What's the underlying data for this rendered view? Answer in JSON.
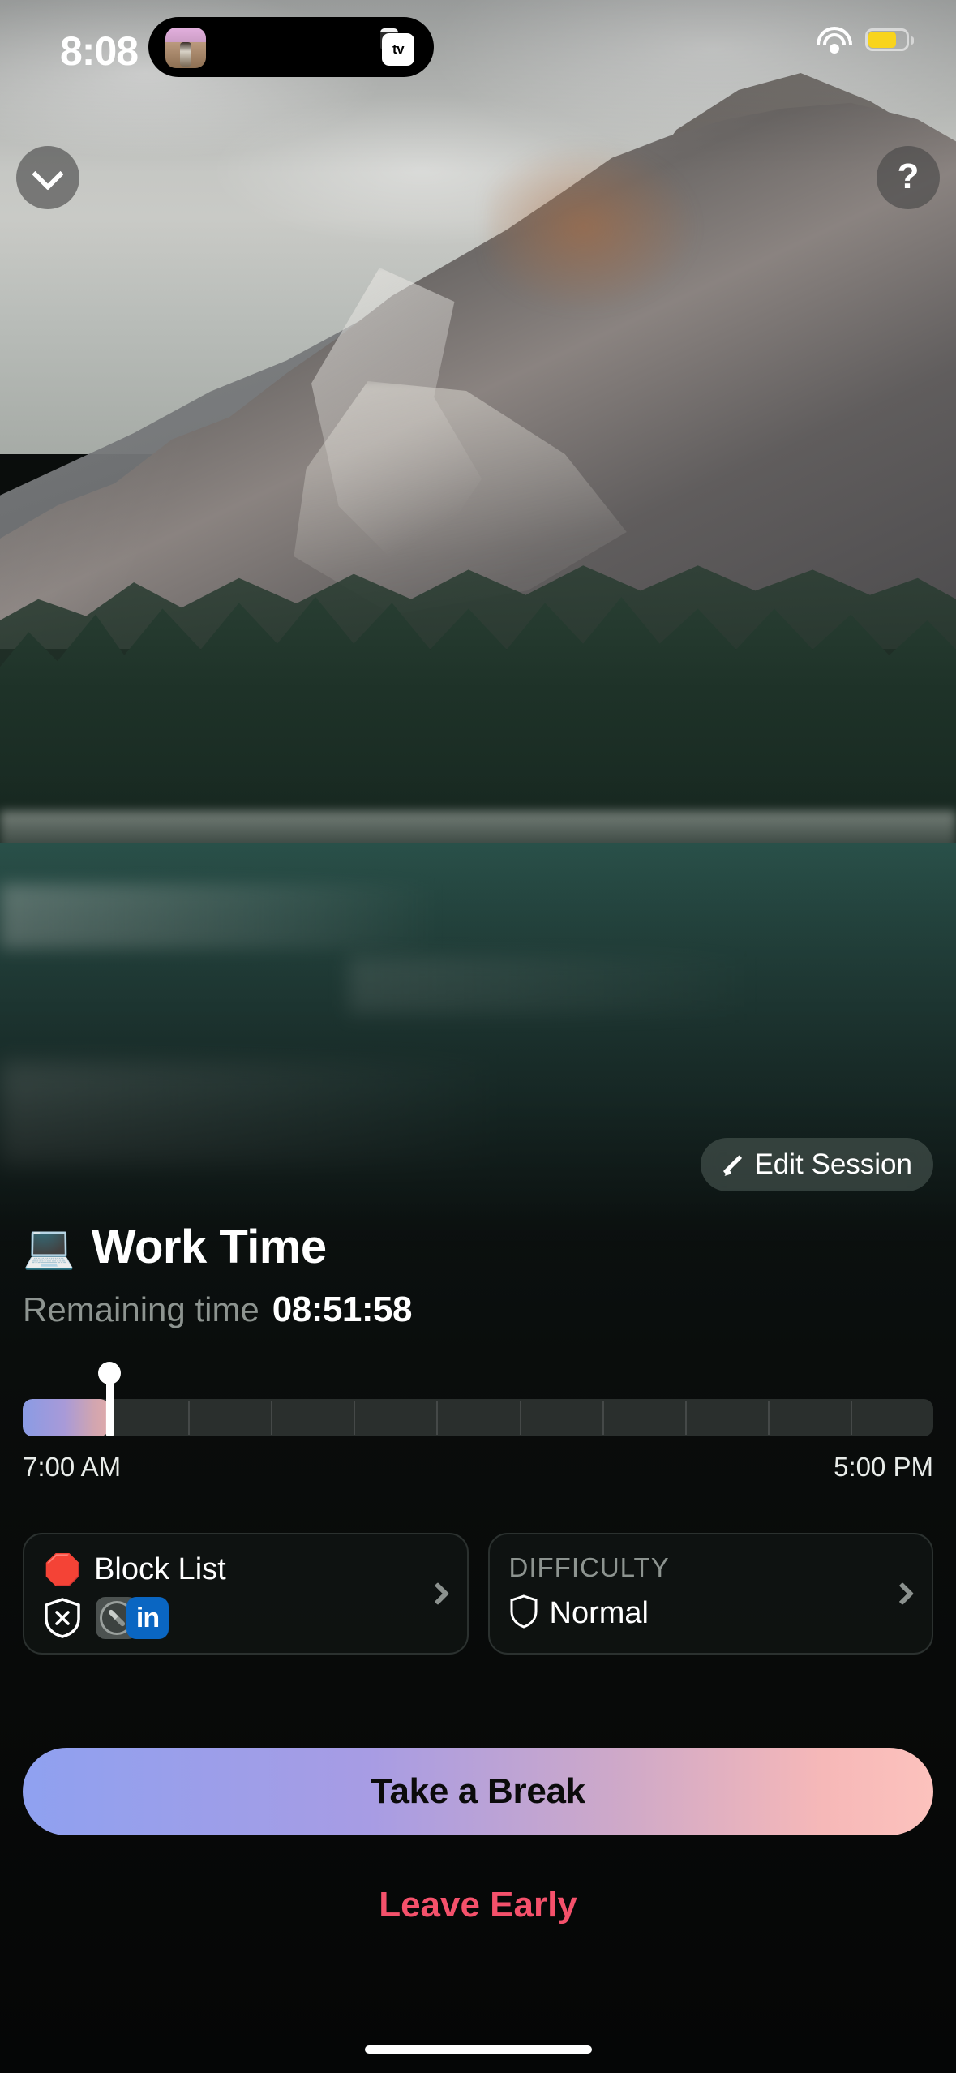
{
  "status_bar": {
    "time": "8:08",
    "dynamic_island": {
      "live_activity_app": "apple-tv",
      "badge_label": "tv",
      "artwork_alt": "album-artwork"
    },
    "wifi_icon": "wifi-icon",
    "battery_icon": "battery-low-power-icon"
  },
  "overlay_buttons": {
    "collapse_icon": "chevron-down-icon",
    "help_label": "?"
  },
  "edit_session": {
    "icon": "pencil-icon",
    "label": "Edit Session"
  },
  "session": {
    "emoji": "💻",
    "title": "Work Time",
    "remaining_label": "Remaining time",
    "remaining_value": "08:51:58"
  },
  "timeline": {
    "start_label": "7:00 AM",
    "end_label": "5:00 PM",
    "progress_percent": 9.5,
    "marker_percent": 9.5,
    "tick_count": 10,
    "fill_gradient_start": "#8a9be4",
    "fill_gradient_end": "#e0aaaa"
  },
  "cards": {
    "block_list": {
      "emoji": "🛑",
      "title": "Block List",
      "chevron_icon": "chevron-right-icon",
      "apps": [
        {
          "name": "shield-block-icon",
          "label": ""
        },
        {
          "name": "safari-icon",
          "label": ""
        },
        {
          "name": "linkedin-icon",
          "label": "in"
        }
      ]
    },
    "difficulty": {
      "label": "DIFFICULTY",
      "icon": "shield-icon",
      "value": "Normal",
      "chevron_icon": "chevron-right-icon"
    }
  },
  "actions": {
    "primary_label": "Take a Break",
    "primary_gradient_start": "#8fa1f0",
    "primary_gradient_end": "#fcc2bd",
    "secondary_label": "Leave Early",
    "secondary_color": "#f4516b"
  }
}
